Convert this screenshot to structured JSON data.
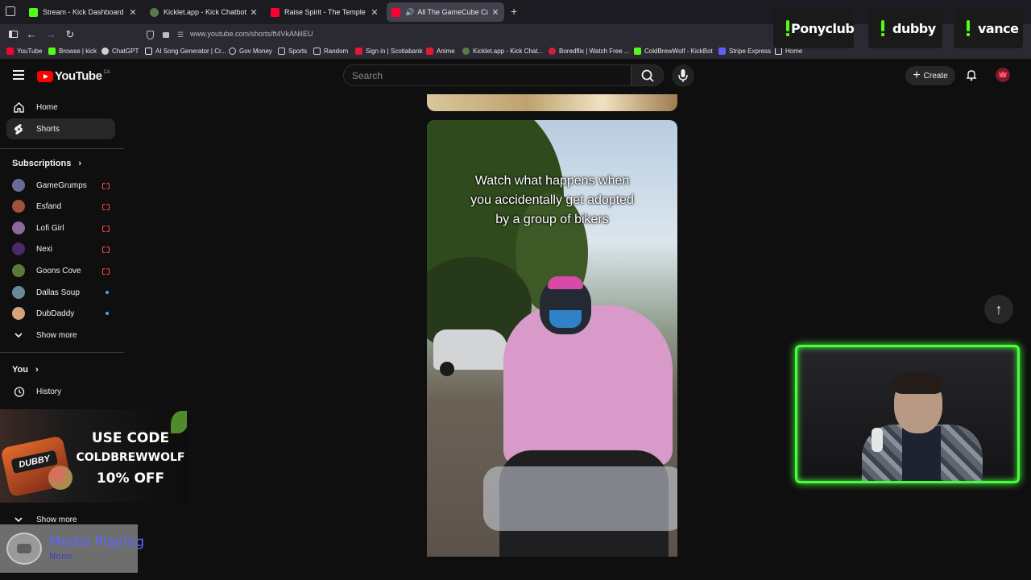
{
  "browser": {
    "tabs": [
      {
        "title": "Stream - Kick Dashboard",
        "fav_color": "#53fc18"
      },
      {
        "title": "Kicklet.app - Kick Chatbot and C",
        "fav_color": "#5a7a4a"
      },
      {
        "title": "Raise Spirit - The Temple - YouT",
        "fav_color": "#ff0033"
      },
      {
        "title": "All The GameCube Compan",
        "fav_color": "#ff0033"
      }
    ],
    "url": "www.youtube.com/shorts/ft4VkANiIEU",
    "bookmarks": [
      {
        "label": "YouTube",
        "color": "#ff0033"
      },
      {
        "label": "Browse | kick",
        "color": "#53fc18"
      },
      {
        "label": "ChatGPT",
        "color": "#cfcfcf"
      },
      {
        "label": "AI Song Generator | Cr...",
        "color": "#e6e6e6"
      },
      {
        "label": "Gov Money",
        "color": "#cfcfcf"
      },
      {
        "label": "Sports",
        "color": "#cfcfcf"
      },
      {
        "label": "Random",
        "color": "#cfcfcf"
      },
      {
        "label": "Sign in | Scotiabank",
        "color": "#e31837"
      },
      {
        "label": "Anime",
        "color": "#e31837"
      },
      {
        "label": "Kicklet.app - Kick Chat...",
        "color": "#5a7a4a"
      },
      {
        "label": "Boredflix | Watch Free ...",
        "color": "#d3203a"
      },
      {
        "label": "ColdBrewWolf - KickBot",
        "color": "#53fc18"
      },
      {
        "label": "Stripe Express",
        "color": "#635bff"
      },
      {
        "label": "Home",
        "color": "#e6e6e6"
      }
    ]
  },
  "youtube": {
    "logo_text": "YouTube",
    "country": "CA",
    "search_placeholder": "Search",
    "create_label": "Create",
    "nav": {
      "home": "Home",
      "shorts": "Shorts"
    },
    "subscriptions_title": "Subscriptions",
    "subscriptions": [
      {
        "name": "GameGrumps",
        "status": "live",
        "avatar_color": "#6b6b9a"
      },
      {
        "name": "Esfand",
        "status": "live",
        "avatar_color": "#a0523a"
      },
      {
        "name": "Lofi Girl",
        "status": "live",
        "avatar_color": "#8a6a9c"
      },
      {
        "name": "Nexi",
        "status": "live",
        "avatar_color": "#4a2a6a"
      },
      {
        "name": "Goons Cove",
        "status": "live",
        "avatar_color": "#5a7a3a"
      },
      {
        "name": "Dallas Soup",
        "status": "new",
        "avatar_color": "#6a8a9a"
      },
      {
        "name": "DubDaddy",
        "status": "new",
        "avatar_color": "#d6a27a"
      }
    ],
    "show_more": "Show more",
    "you_title": "You",
    "history": "History",
    "show_more_2": "Show more",
    "live_color": "#ff4e45",
    "new_color": "#3ea6ff"
  },
  "short": {
    "caption_lines": [
      "Watch what happens when",
      "you accidentally get adopted",
      "by a group of bikers"
    ]
  },
  "overlay": {
    "ad_lines": [
      "USE CODE",
      "COLDBREWWOLF",
      "10% OFF"
    ],
    "ad_brand": "DUBBY",
    "media_title": "Media Playing",
    "media_sub": "None",
    "alerts": [
      "Ponyclub",
      "dubby",
      "vance"
    ],
    "cam_border_color": "#46ff3c"
  }
}
